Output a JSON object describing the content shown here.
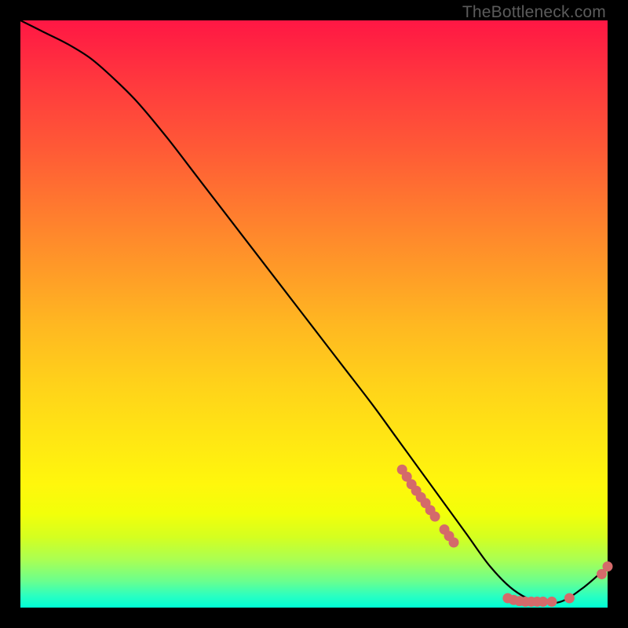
{
  "watermark": "TheBottleneck.com",
  "chart_data": {
    "type": "line",
    "title": "",
    "xlabel": "",
    "ylabel": "",
    "xlim": [
      0,
      100
    ],
    "ylim": [
      0,
      100
    ],
    "grid": false,
    "legend": false,
    "series": [
      {
        "name": "curve",
        "x": [
          0,
          4,
          8,
          12,
          16,
          20,
          25,
          30,
          35,
          40,
          45,
          50,
          55,
          60,
          64,
          68,
          72,
          76,
          80,
          84,
          88,
          92,
          96,
          100
        ],
        "y": [
          100,
          98,
          96,
          93.5,
          90,
          86,
          80,
          73.5,
          67,
          60.5,
          54,
          47.5,
          41,
          34.5,
          29,
          23.5,
          18,
          12.5,
          7,
          3,
          1,
          1,
          3.5,
          7
        ]
      }
    ],
    "markers": [
      {
        "x": 65.0,
        "y": 23.5
      },
      {
        "x": 65.8,
        "y": 22.3
      },
      {
        "x": 66.6,
        "y": 21.0
      },
      {
        "x": 67.4,
        "y": 19.9
      },
      {
        "x": 68.2,
        "y": 18.8
      },
      {
        "x": 69.0,
        "y": 17.8
      },
      {
        "x": 69.8,
        "y": 16.6
      },
      {
        "x": 70.6,
        "y": 15.5
      },
      {
        "x": 72.2,
        "y": 13.3
      },
      {
        "x": 73.0,
        "y": 12.2
      },
      {
        "x": 73.8,
        "y": 11.1
      },
      {
        "x": 83.0,
        "y": 1.6
      },
      {
        "x": 84.0,
        "y": 1.3
      },
      {
        "x": 85.0,
        "y": 1.1
      },
      {
        "x": 86.0,
        "y": 1.0
      },
      {
        "x": 87.0,
        "y": 1.0
      },
      {
        "x": 88.0,
        "y": 1.0
      },
      {
        "x": 89.0,
        "y": 1.0
      },
      {
        "x": 90.5,
        "y": 1.0
      },
      {
        "x": 93.5,
        "y": 1.6
      },
      {
        "x": 99.0,
        "y": 5.7
      },
      {
        "x": 100.0,
        "y": 7.0
      }
    ],
    "marker_radius": 6.5,
    "colors": {
      "curve": "#000000",
      "markers": "#d46a6a"
    }
  }
}
